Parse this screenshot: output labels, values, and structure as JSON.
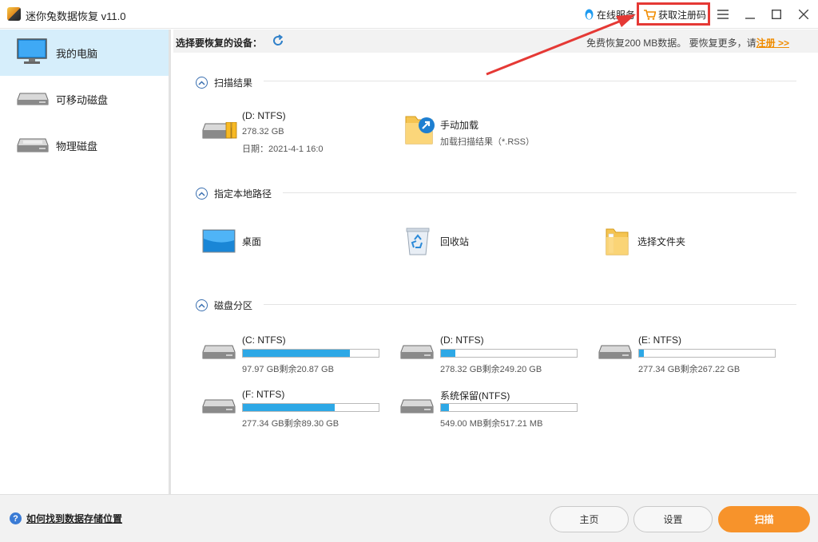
{
  "window": {
    "title": "迷你兔数据恢复 v11.0",
    "online_service": "在线服务",
    "get_code": "获取注册码"
  },
  "sidebar": {
    "items": [
      {
        "label": "我的电脑"
      },
      {
        "label": "可移动磁盘"
      },
      {
        "label": "物理磁盘"
      }
    ]
  },
  "topbar": {
    "label": "选择要恢复的设备：",
    "free_text": "免费恢复200 MB数据。 要恢复更多，请",
    "register_link": "注册 >>"
  },
  "scan_results": {
    "title": "扫描结果",
    "items": [
      {
        "name": "(D: NTFS)",
        "size": "278.32 GB",
        "date": "日期：2021-4-1 16:0"
      },
      {
        "name": "手动加载",
        "sub": "加载扫描结果（*.RSS）"
      }
    ]
  },
  "local_path": {
    "title": "指定本地路径",
    "items": [
      {
        "name": "桌面"
      },
      {
        "name": "回收站"
      },
      {
        "name": "选择文件夹"
      }
    ]
  },
  "partitions": {
    "title": "磁盘分区",
    "items": [
      {
        "name": "(C: NTFS)",
        "info": "97.97 GB剩余20.87 GB",
        "used_pct": 78.7
      },
      {
        "name": "(D: NTFS)",
        "info": "278.32 GB剩余249.20 GB",
        "used_pct": 10.5
      },
      {
        "name": "(E: NTFS)",
        "info": "277.34 GB剩余267.22 GB",
        "used_pct": 3.6
      },
      {
        "name": "(F: NTFS)",
        "info": "277.34 GB剩余89.30 GB",
        "used_pct": 67.8
      },
      {
        "name": "系统保留(NTFS)",
        "info": "549.00 MB剩余517.21 MB",
        "used_pct": 5.8
      }
    ]
  },
  "footer": {
    "help": "如何找到数据存储位置",
    "home": "主页",
    "settings": "设置",
    "scan": "扫描"
  },
  "colors": {
    "accent": "#f7932b",
    "bar_fill": "#2da8e6",
    "highlight": "#e53935",
    "selected_bg": "#d6eefb"
  }
}
